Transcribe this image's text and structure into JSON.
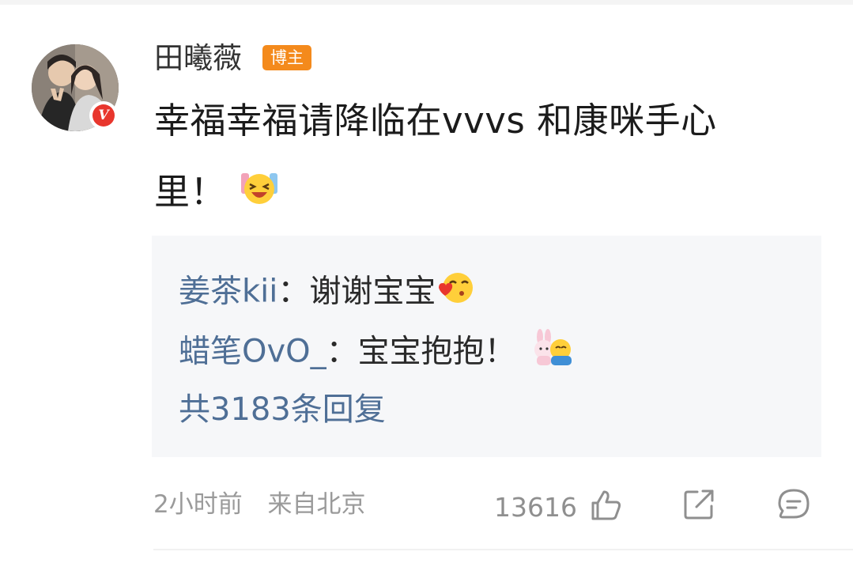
{
  "post": {
    "username": "田曦薇",
    "role_badge": "博主",
    "content_line1": "幸福幸福请降临在vvvs 和康咪手心",
    "content_line2": "里！",
    "content_emoji": "laughing-cheering-emoji",
    "verified_badge": "V"
  },
  "replies": {
    "items": [
      {
        "user": "姜茶kii",
        "separator": "：",
        "text": "谢谢宝宝",
        "emoji": "kiss-heart-emoji"
      },
      {
        "user": "蜡笔OvO_",
        "separator": "：",
        "text": "宝宝抱抱！",
        "emoji": "bunny-hug-emoji"
      }
    ],
    "total": "共3183条回复"
  },
  "footer": {
    "time": "2小时前",
    "source": "来自北京",
    "like_count": "13616",
    "icons": [
      "thumbs-up-icon",
      "share-icon",
      "comment-icon"
    ]
  },
  "colors": {
    "badge": "#f48a1c",
    "verified": "#e8362d",
    "link": "#4f6f96",
    "reply_bg": "#f6f7f9",
    "muted": "#9a9a9a"
  }
}
